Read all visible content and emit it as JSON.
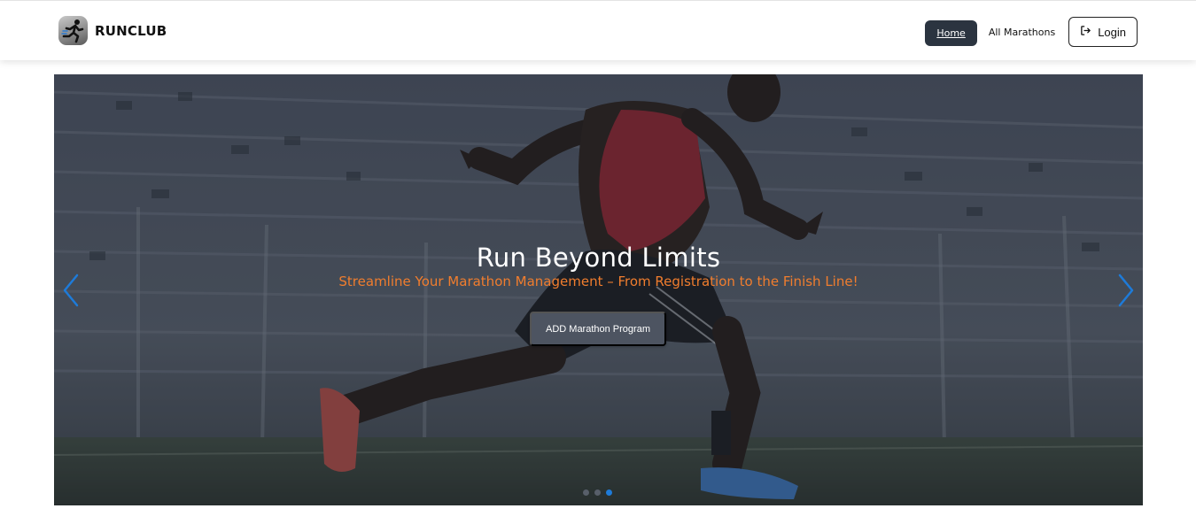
{
  "brand": {
    "name": "RUNCLUB",
    "logo_icon": "runner-icon"
  },
  "nav": {
    "home_label": "Home",
    "all_marathons_label": "All Marathons",
    "login_label": "Login",
    "login_icon": "login-icon"
  },
  "hero": {
    "title": "Run Beyond Limits",
    "subtitle": "Streamline Your Marathon Management – From Registration to the Finish Line!",
    "cta_label": "ADD Marathon Program",
    "slide_count": 3,
    "active_slide": 3
  },
  "colors": {
    "accent_orange": "#f07d2e",
    "nav_active_bg": "#2b3440",
    "carousel_arrow": "#1e7bd9",
    "active_dot": "#1e7bd9"
  }
}
